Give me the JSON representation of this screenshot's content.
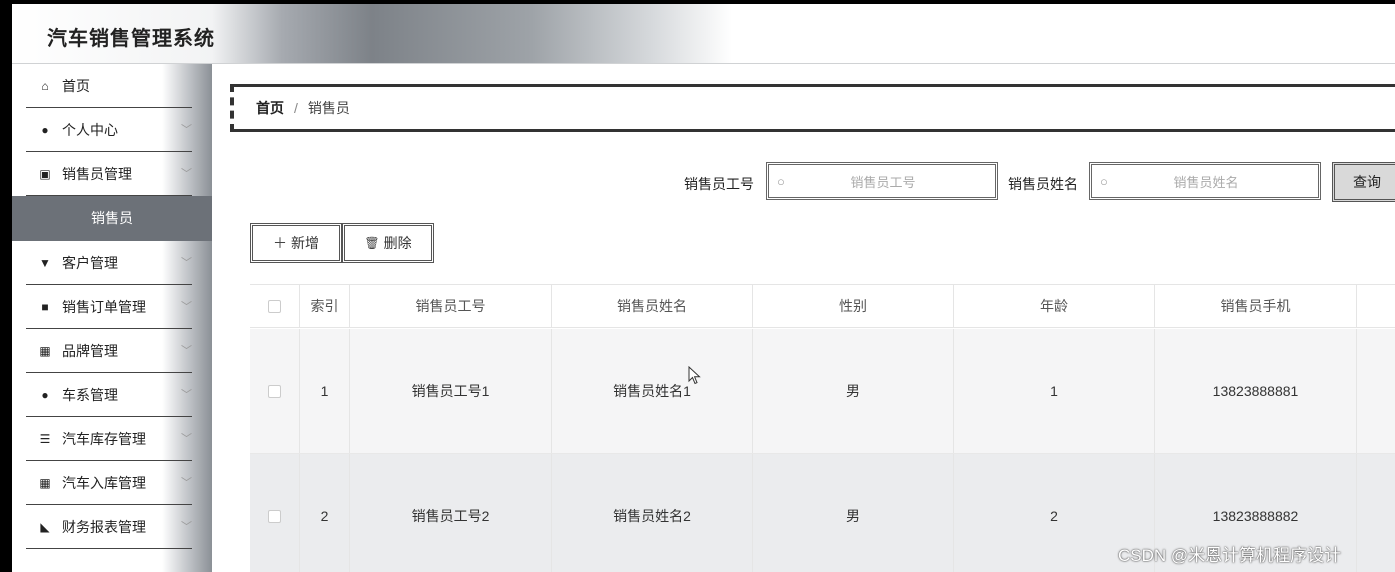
{
  "app": {
    "title": "汽车销售管理系统"
  },
  "sidebar": {
    "items": [
      {
        "label": "首页",
        "icon": "home-icon",
        "glyph": "⌂"
      },
      {
        "label": "个人中心",
        "icon": "user-icon",
        "glyph": "●"
      },
      {
        "label": "销售员管理",
        "icon": "chart-icon",
        "glyph": "▣"
      },
      {
        "label": "客户管理",
        "icon": "pin-icon",
        "glyph": "▼"
      },
      {
        "label": "销售订单管理",
        "icon": "briefcase-icon",
        "glyph": "■"
      },
      {
        "label": "品牌管理",
        "icon": "grid-icon",
        "glyph": "▦"
      },
      {
        "label": "车系管理",
        "icon": "location-icon",
        "glyph": "●"
      },
      {
        "label": "汽车库存管理",
        "icon": "list-icon",
        "glyph": "☰"
      },
      {
        "label": "汽车入库管理",
        "icon": "grid-icon",
        "glyph": "▦"
      },
      {
        "label": "财务报表管理",
        "icon": "like-icon",
        "glyph": "◣"
      }
    ],
    "sub_item": "销售员",
    "chevron": "﹀"
  },
  "breadcrumb": {
    "home": "首页",
    "separator": "/",
    "current": "销售员"
  },
  "search": {
    "field1_label": "销售员工号",
    "field1_placeholder": "销售员工号",
    "field2_label": "销售员姓名",
    "field2_placeholder": "销售员姓名",
    "query_button": "查询",
    "mag_glyph": "○"
  },
  "actions": {
    "add_label": "新增",
    "add_glyph": "＋",
    "delete_label": "删除",
    "delete_glyph": "🗑"
  },
  "table": {
    "headers": [
      "索引",
      "销售员工号",
      "销售员姓名",
      "性别",
      "年龄",
      "销售员手机"
    ],
    "rows": [
      {
        "index": "1",
        "id": "销售员工号1",
        "name": "销售员姓名1",
        "gender": "男",
        "age": "1",
        "phone": "13823888881"
      },
      {
        "index": "2",
        "id": "销售员工号2",
        "name": "销售员姓名2",
        "gender": "男",
        "age": "2",
        "phone": "13823888882"
      }
    ]
  },
  "watermark": "CSDN @米恩计算机程序设计"
}
